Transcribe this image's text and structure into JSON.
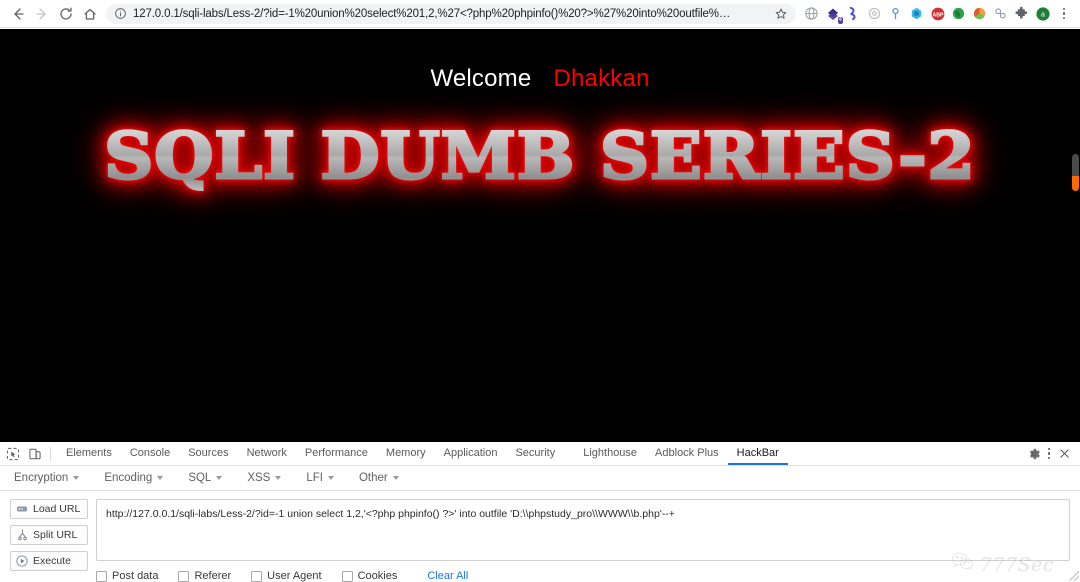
{
  "browser": {
    "nav": {
      "back": "back-arrow",
      "forward": "forward-arrow",
      "reload": "reload",
      "home": "home"
    },
    "omnibox": {
      "info_icon": "page-info-icon",
      "url": "127.0.0.1/sqli-labs/Less-2/?id=-1%20union%20select%201,2,%27<?php%20phpinfo()%20?>%27%20into%20outfile%…",
      "star_icon": "bookmark-star-icon"
    },
    "extensions": [
      {
        "name": "globe-extension-icon",
        "color": "#9aa0a6",
        "badge": ""
      },
      {
        "name": "proxy-switchy-extension-icon",
        "color": "#3b2a80",
        "badge": "4"
      },
      {
        "name": "wappalyzer-extension-icon",
        "color": "#4f4fd0",
        "badge": ""
      },
      {
        "name": "grey-gear-extension-icon",
        "color": "#b9bdc2",
        "badge": ""
      },
      {
        "name": "location-pin-extension-icon",
        "color": "#4a9ae8",
        "badge": ""
      },
      {
        "name": "hackbar-extension-icon",
        "color": "#2fb8e8",
        "badge": ""
      },
      {
        "name": "adblock-plus-extension-icon",
        "color": "#d32f2f",
        "badge": "ABP"
      },
      {
        "name": "green-globe-extension-icon",
        "color": "#2e9e4a",
        "badge": ""
      },
      {
        "name": "colorful-circle-extension-icon",
        "color": "#e05a2b",
        "badge": ""
      },
      {
        "name": "link-extension-icon",
        "color": "#8e9aa6",
        "badge": ""
      },
      {
        "name": "puzzle-extensions-icon",
        "color": "#5f6368",
        "badge": ""
      },
      {
        "name": "profile-avatar-icon",
        "color": "#1e7e34",
        "badge": "A"
      }
    ],
    "menu_icon": "chrome-menu-icon"
  },
  "page": {
    "welcome": "Welcome",
    "user": "Dhakkan",
    "banner": "SQLI DUMB SERIES-2",
    "background_color": "#000000",
    "welcome_color": "#ffffff",
    "user_color": "#ff0000"
  },
  "devtools": {
    "inspect_icon": "inspect-element-icon",
    "device_icon": "device-toolbar-icon",
    "tabs": [
      {
        "label": "Elements",
        "active": false
      },
      {
        "label": "Console",
        "active": false
      },
      {
        "label": "Sources",
        "active": false
      },
      {
        "label": "Network",
        "active": false
      },
      {
        "label": "Performance",
        "active": false
      },
      {
        "label": "Memory",
        "active": false
      },
      {
        "label": "Application",
        "active": false
      },
      {
        "label": "Security",
        "active": false
      },
      {
        "label": "Lighthouse",
        "active": false
      },
      {
        "label": "Adblock Plus",
        "active": false
      },
      {
        "label": "HackBar",
        "active": true
      }
    ],
    "settings_icon": "gear-icon",
    "more_icon": "more-options-icon",
    "close_icon": "close-icon",
    "active_tab_color": "#1a73e8"
  },
  "hackbar": {
    "menus": [
      {
        "label": "Encryption"
      },
      {
        "label": "Encoding"
      },
      {
        "label": "SQL"
      },
      {
        "label": "XSS"
      },
      {
        "label": "LFI"
      },
      {
        "label": "Other"
      }
    ],
    "buttons": [
      {
        "label": "Load URL",
        "icon": "load-url-icon"
      },
      {
        "label": "Split URL",
        "icon": "split-url-icon"
      },
      {
        "label": "Execute",
        "icon": "execute-icon"
      }
    ],
    "url_value": "http://127.0.0.1/sqli-labs/Less-2/?id=-1 union select 1,2,'<?php phpinfo() ?>' into outfile 'D:\\\\phpstudy_pro\\\\WWW\\\\b.php'--+",
    "checkboxes": [
      {
        "label": "Post data",
        "checked": false
      },
      {
        "label": "Referer",
        "checked": false
      },
      {
        "label": "User Agent",
        "checked": false
      },
      {
        "label": "Cookies",
        "checked": false
      }
    ],
    "clear_all": "Clear All",
    "clear_all_color": "#1a73e8"
  },
  "watermark": {
    "text": "777Sec",
    "icon": "wechat-icon"
  }
}
